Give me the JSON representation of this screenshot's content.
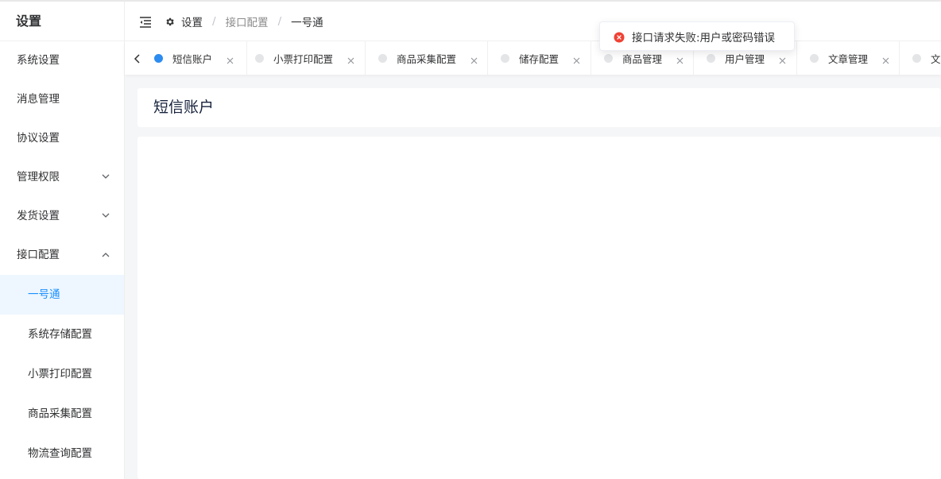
{
  "sidebar": {
    "title": "设置",
    "items": [
      {
        "label": "系统设置"
      },
      {
        "label": "消息管理"
      },
      {
        "label": "协议设置"
      },
      {
        "label": "管理权限"
      },
      {
        "label": "发货设置"
      },
      {
        "label": "接口配置"
      }
    ],
    "sub_items": [
      {
        "label": "一号通"
      },
      {
        "label": "系统存储配置"
      },
      {
        "label": "小票打印配置"
      },
      {
        "label": "商品采集配置"
      },
      {
        "label": "物流查询配置"
      }
    ]
  },
  "breadcrumb": {
    "root": "设置",
    "parent": "接口配置",
    "current": "一号通",
    "separator": "/"
  },
  "tabs": [
    {
      "label": "短信账户"
    },
    {
      "label": "小票打印配置"
    },
    {
      "label": "商品采集配置"
    },
    {
      "label": "储存配置"
    },
    {
      "label": "商品管理"
    },
    {
      "label": "用户管理"
    },
    {
      "label": "文章管理"
    },
    {
      "label": "文"
    }
  ],
  "page": {
    "title": "短信账户"
  },
  "toast": {
    "message": "接口请求失败:用户或密码错误"
  },
  "colors": {
    "accent": "#1890ff",
    "active_dot": "#2d8cf0",
    "error": "#f04134"
  }
}
